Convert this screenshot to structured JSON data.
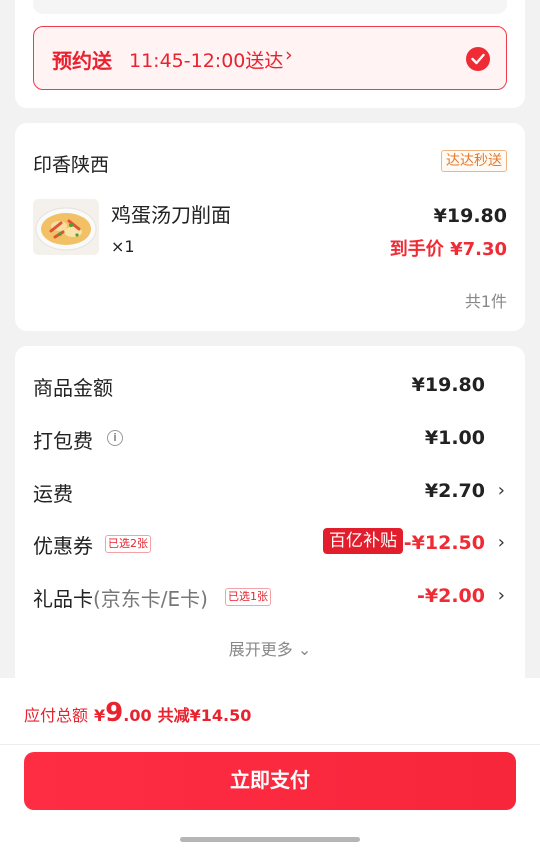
{
  "delivery": {
    "schedule_label": "预约送",
    "schedule_time": "11:45-12:00送达",
    "schedule_arrow": "›"
  },
  "store": {
    "name": "印香陕西",
    "badge": "达达秒送",
    "item": {
      "name": "鸡蛋汤刀削面",
      "qty": "×1",
      "price": "¥19.80",
      "final_price": "到手价 ¥7.30"
    },
    "count": "共1件"
  },
  "fees": {
    "goods": {
      "label": "商品金额",
      "value": "¥19.80"
    },
    "packing": {
      "label": "打包费",
      "info": "i",
      "value": "¥1.00"
    },
    "shipping": {
      "label": "运费",
      "value": "¥2.70",
      "chevron": "›"
    },
    "coupon": {
      "label": "优惠券",
      "tag": "已选2张",
      "subsidy_badge": "百亿补贴",
      "value": "-¥12.50",
      "chevron": "›"
    },
    "giftcard": {
      "label": "礼品卡",
      "label_sub": "(京东卡/E卡)",
      "tag": "已选1张",
      "value": "-¥2.00",
      "chevron": "›"
    },
    "expand_more": "展开更多 ⌄"
  },
  "footer": {
    "total_label": "应付总额",
    "currency": "¥",
    "total_int": "9",
    "total_dec": ".00",
    "saved": "共减¥14.50",
    "pay_button": "立即支付"
  },
  "colors": {
    "accent_red": "#ef2b35",
    "badge_orange": "#e27b2f",
    "background": "#f2f2f2"
  }
}
